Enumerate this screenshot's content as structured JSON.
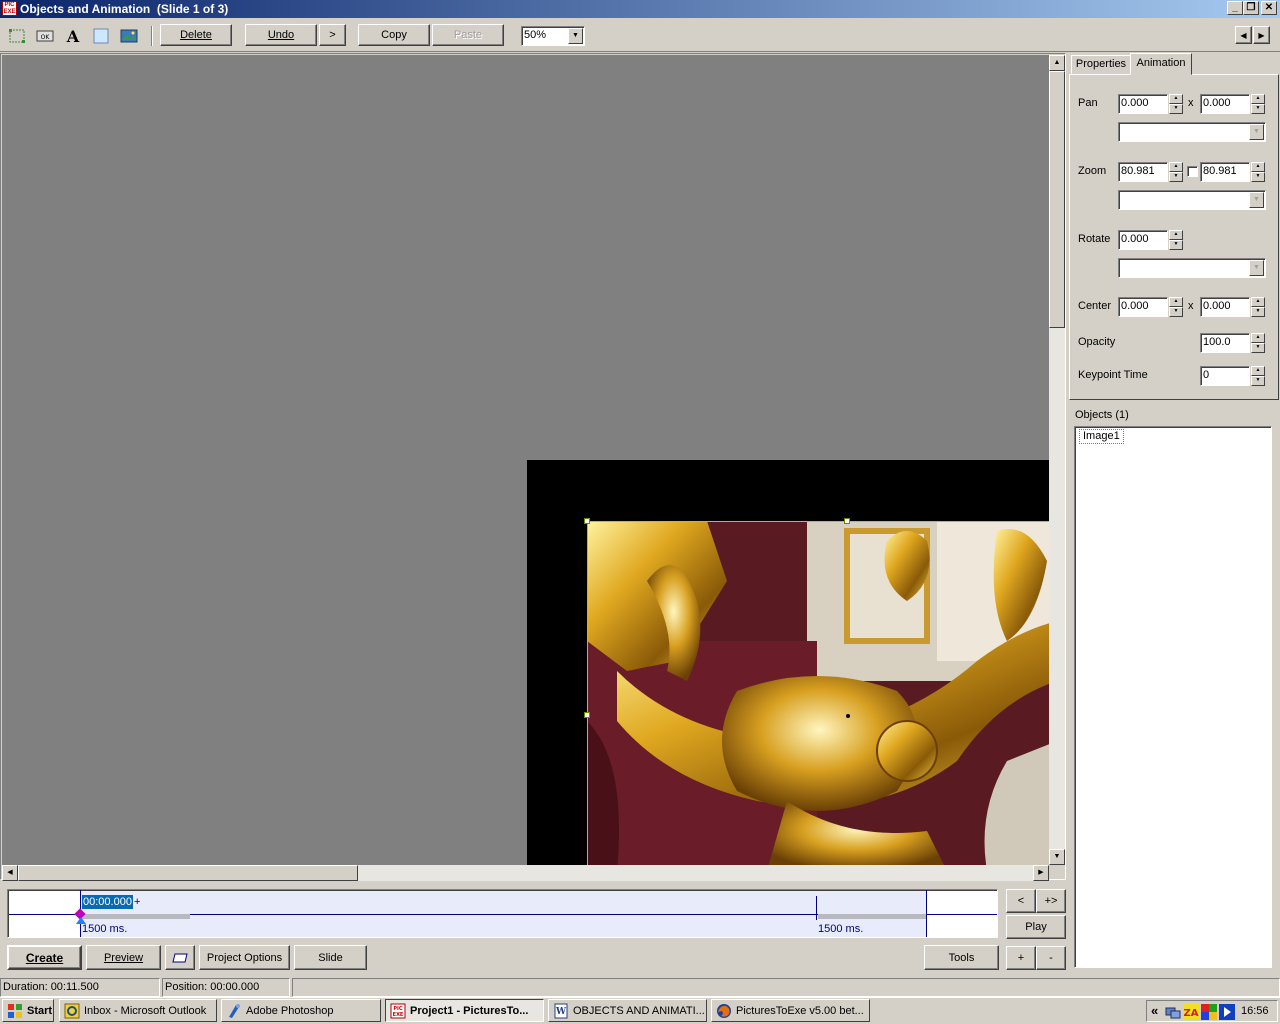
{
  "window": {
    "title": "Objects and Animation  (Slide 1 of 3)"
  },
  "toolbar": {
    "delete_label": "Delete",
    "undo_label": "Undo",
    "redo_label": ">",
    "copy_label": "Copy",
    "paste_label": "Paste",
    "zoom_value": "50%",
    "prev_label": "◀",
    "next_label": "▶"
  },
  "tabs": [
    {
      "label": "Properties"
    },
    {
      "label": "Animation"
    }
  ],
  "animation": {
    "pan_label": "Pan",
    "pan_x": "0.000",
    "pan_y": "0.000",
    "zoom_label": "Zoom",
    "zoom_x": "80.981",
    "zoom_y": "80.981",
    "rotate_label": "Rotate",
    "rotate": "0.000",
    "center_label": "Center",
    "center_x": "0.000",
    "center_y": "0.000",
    "x_sep": "x",
    "opacity_label": "Opacity",
    "opacity": "100.0",
    "keypoint_label": "Keypoint Time",
    "keypoint": "0"
  },
  "objects": {
    "header": "Objects (1)",
    "items": [
      "Image1"
    ]
  },
  "timeline": {
    "current_time": "00:00.000",
    "plus": "+",
    "left_duration": "1500 ms.",
    "right_duration": "1500 ms.",
    "prev_btn": "<",
    "add_btn": "+>",
    "play_btn": "Play",
    "plus_btn": "+",
    "minus_btn": "-"
  },
  "bottom_buttons": {
    "create": "Create",
    "preview": "Preview",
    "project_options": "Project Options",
    "slide": "Slide",
    "tools": "Tools"
  },
  "status": {
    "duration": "Duration:  00:11.500",
    "position": "Position:  00:00.000"
  },
  "taskbar": {
    "start": "Start",
    "items": [
      "Inbox - Microsoft Outlook",
      "Adobe Photoshop",
      "Project1 - PicturesTo...",
      "OBJECTS AND ANIMATI...",
      "PicturesToExe v5.00 bet..."
    ],
    "tray_chevron": "«",
    "clock": "16:56"
  }
}
